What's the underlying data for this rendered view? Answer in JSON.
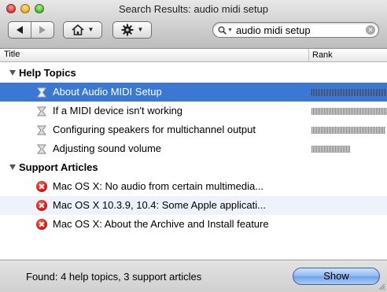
{
  "window": {
    "title": "Search Results: audio midi setup"
  },
  "toolbar": {
    "home_icon": "house-icon",
    "action_icon": "gear-icon"
  },
  "search": {
    "value": "audio midi setup",
    "placeholder": ""
  },
  "columns": {
    "title": "Title",
    "rank": "Rank"
  },
  "groups": [
    {
      "label": "Help Topics",
      "items": [
        {
          "label": "About Audio MIDI Setup",
          "rank": 1.0,
          "selected": true
        },
        {
          "label": "If a MIDI device isn't working",
          "rank": 1.0,
          "selected": false
        },
        {
          "label": "Configuring speakers for multichannel output",
          "rank": 0.98,
          "selected": false
        },
        {
          "label": "Adjusting sound volume",
          "rank": 0.51,
          "selected": false
        }
      ]
    },
    {
      "label": "Support Articles",
      "items": [
        {
          "label": "Mac OS X: No audio from certain multimedia..."
        },
        {
          "label": "Mac OS X 10.3.9, 10.4: Some Apple applicati..."
        },
        {
          "label": "Mac OS X: About the Archive and Install feature"
        }
      ]
    }
  ],
  "footer": {
    "status": "Found: 4 help topics, 3 support articles",
    "show_label": "Show"
  },
  "colors": {
    "selection": "#3a78d4",
    "alternate_row": "#eef3fb",
    "support_icon": "#d41a12"
  }
}
